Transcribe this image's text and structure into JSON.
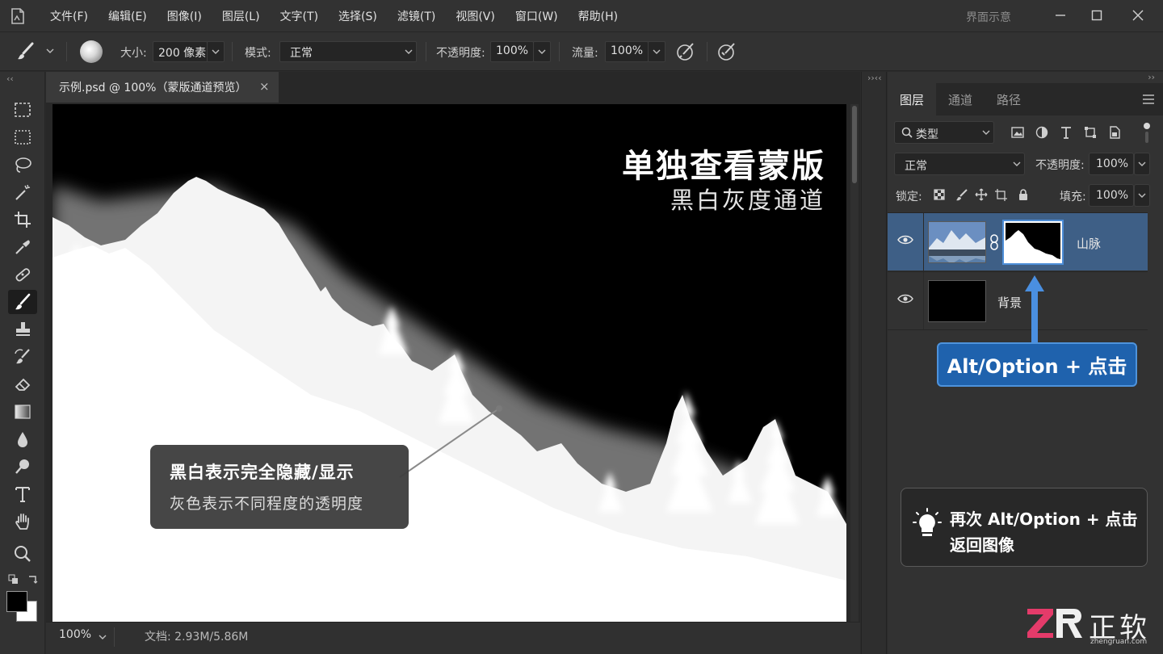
{
  "menubar": {
    "items": [
      "文件(F)",
      "编辑(E)",
      "图像(I)",
      "图层(L)",
      "文字(T)",
      "选择(S)",
      "滤镜(T)",
      "视图(V)",
      "窗口(W)",
      "帮助(H)"
    ],
    "workspace": "界面示意"
  },
  "options": {
    "size_label": "大小:",
    "size_value": "200 像素",
    "mode_label": "模式:",
    "mode_value": "正常",
    "opacity_label": "不透明度:",
    "opacity_value": "100%",
    "flow_label": "流量:",
    "flow_value": "100%"
  },
  "document": {
    "tab_title": "示例.psd @ 100%（蒙版通道预览）",
    "close_glyph": "×"
  },
  "canvas": {
    "title": "单独查看蒙版",
    "subtitle": "黑白灰度通道",
    "callout_line1": "黑白表示完全隐藏/显示",
    "callout_line2": "灰色表示不同程度的透明度"
  },
  "status": {
    "zoom": "100%",
    "doc_info": "文档: 2.93M/5.86M"
  },
  "layers_panel": {
    "tabs": [
      "图层",
      "通道",
      "路径"
    ],
    "filter_value": "类型",
    "blend_mode": "正常",
    "opacity_label": "不透明度:",
    "opacity_value": "100%",
    "lock_label": "锁定:",
    "fill_label": "填充:",
    "fill_value": "100%",
    "layers": [
      {
        "name": "山脉",
        "selected": true
      },
      {
        "name": "背景",
        "selected": false
      }
    ],
    "hint_badge": "Alt/Option + 点击",
    "tip_line1": "再次 Alt/Option + 点击",
    "tip_line2": "返回图像"
  },
  "watermark": {
    "brand": "正软",
    "url": "zhengruan.com"
  },
  "colors": {
    "selected_layer": "#3e5f86",
    "accent_blue": "#1f62ad",
    "accent_blue_border": "#4e93dc",
    "watermark_pink": "#e43b6a"
  }
}
